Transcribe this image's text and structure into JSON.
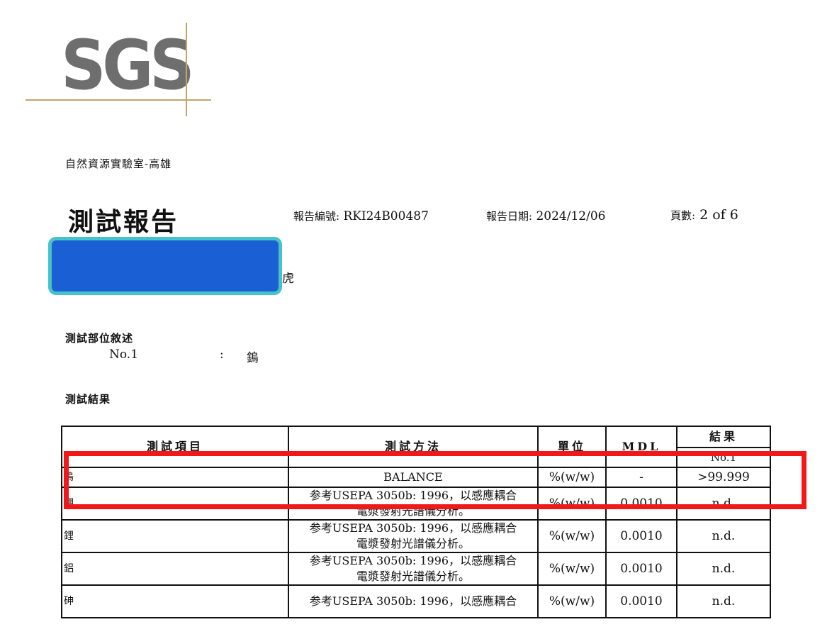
{
  "logo": {
    "text": "SGS"
  },
  "header": {
    "lab_name": "自然資源實驗室-高雄",
    "title": "測試報告",
    "report_no_label": "報告編號:",
    "report_no": "RKI24B00487",
    "report_date_label": "報告日期:",
    "report_date": "2024/12/06",
    "pages_label": "頁數:",
    "pages": "2 of 6",
    "partial_text": "虎"
  },
  "parts": {
    "heading": "測試部位敘述",
    "items": [
      {
        "no": "No.1",
        "colon": ":",
        "desc": "鎢"
      }
    ]
  },
  "results": {
    "heading": "測試結果",
    "columns": {
      "item": "測試項目",
      "method": "測試方法",
      "unit": "單位",
      "mdl": "MDL",
      "result": "結果",
      "result_sub": "No.1"
    },
    "rows": [
      {
        "item": "鎢",
        "method_1": "BALANCE",
        "method_2": "",
        "unit": "%(w/w)",
        "mdl": "-",
        "result": ">99.999"
      },
      {
        "item": "硼",
        "method_1": "参考USEPA 3050b: 1996，以感應耦合",
        "method_2": "電漿發射光譜儀分析。",
        "unit": "%(w/w)",
        "mdl": "0.0010",
        "result": "n.d."
      },
      {
        "item": "鋰",
        "method_1": "参考USEPA 3050b: 1996，以感應耦合",
        "method_2": "電漿發射光譜儀分析。",
        "unit": "%(w/w)",
        "mdl": "0.0010",
        "result": "n.d."
      },
      {
        "item": "鋁",
        "method_1": "参考USEPA 3050b: 1996，以感應耦合",
        "method_2": "電漿發射光譜儀分析。",
        "unit": "%(w/w)",
        "mdl": "0.0010",
        "result": "n.d."
      },
      {
        "item": "砷",
        "method_1": "参考USEPA 3050b: 1996，以感應耦合",
        "method_2": "",
        "unit": "%(w/w)",
        "mdl": "0.0010",
        "result": "n.d."
      }
    ]
  },
  "annotations": {
    "redaction_color": "#1b5fd4",
    "redaction_border_color": "#45c3c8",
    "highlight_color": "#f01818"
  }
}
